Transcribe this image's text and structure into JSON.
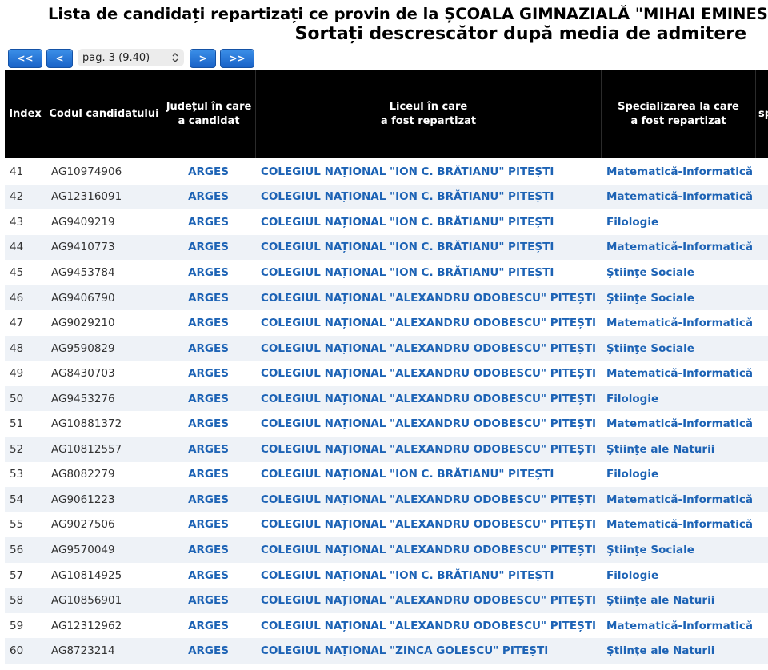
{
  "header": {
    "title": "Lista de candidați repartizați ce provin de la ȘCOALA GIMNAZIALĂ \"MIHAI EMINESCU\"",
    "subtitle": "Sortați descrescător după media de admitere"
  },
  "pager": {
    "first": "<<",
    "prev": "<",
    "select_value": "pag. 3 (9.40)",
    "next": ">",
    "last": ">>"
  },
  "table": {
    "headers": {
      "index": "Index",
      "code": "Codul candidatului",
      "judet_1": "Județul în care",
      "judet_2": "a candidat",
      "liceu_1": "Liceul în care",
      "liceu_2": "a fost repartizat",
      "spec_1": "Specializarea la care",
      "spec_2": "a fost repartizat",
      "extra": "sp"
    },
    "rows": [
      {
        "index": "41",
        "code": "AG10974906",
        "judet": "ARGES",
        "liceu": "COLEGIUL NAȚIONAL \"ION C. BRĂTIANU\" PITEȘTI",
        "spec": "Matematică-Informatică"
      },
      {
        "index": "42",
        "code": "AG12316091",
        "judet": "ARGES",
        "liceu": "COLEGIUL NAȚIONAL \"ION C. BRĂTIANU\" PITEȘTI",
        "spec": "Matematică-Informatică"
      },
      {
        "index": "43",
        "code": "AG9409219",
        "judet": "ARGES",
        "liceu": "COLEGIUL NAȚIONAL \"ION C. BRĂTIANU\" PITEȘTI",
        "spec": "Filologie"
      },
      {
        "index": "44",
        "code": "AG9410773",
        "judet": "ARGES",
        "liceu": "COLEGIUL NAȚIONAL \"ION C. BRĂTIANU\" PITEȘTI",
        "spec": "Matematică-Informatică"
      },
      {
        "index": "45",
        "code": "AG9453784",
        "judet": "ARGES",
        "liceu": "COLEGIUL NAȚIONAL \"ION C. BRĂTIANU\" PITEȘTI",
        "spec": "Ştiinţe Sociale"
      },
      {
        "index": "46",
        "code": "AG9406790",
        "judet": "ARGES",
        "liceu": "COLEGIUL NAȚIONAL \"ALEXANDRU ODOBESCU\" PITEȘTI",
        "spec": "Ştiinţe Sociale"
      },
      {
        "index": "47",
        "code": "AG9029210",
        "judet": "ARGES",
        "liceu": "COLEGIUL NAȚIONAL \"ALEXANDRU ODOBESCU\" PITEȘTI",
        "spec": "Matematică-Informatică"
      },
      {
        "index": "48",
        "code": "AG9590829",
        "judet": "ARGES",
        "liceu": "COLEGIUL NAȚIONAL \"ALEXANDRU ODOBESCU\" PITEȘTI",
        "spec": "Ştiinţe Sociale"
      },
      {
        "index": "49",
        "code": "AG8430703",
        "judet": "ARGES",
        "liceu": "COLEGIUL NAȚIONAL \"ALEXANDRU ODOBESCU\" PITEȘTI",
        "spec": "Matematică-Informatică"
      },
      {
        "index": "50",
        "code": "AG9453276",
        "judet": "ARGES",
        "liceu": "COLEGIUL NAȚIONAL \"ALEXANDRU ODOBESCU\" PITEȘTI",
        "spec": "Filologie"
      },
      {
        "index": "51",
        "code": "AG10881372",
        "judet": "ARGES",
        "liceu": "COLEGIUL NAȚIONAL \"ALEXANDRU ODOBESCU\" PITEȘTI",
        "spec": "Matematică-Informatică"
      },
      {
        "index": "52",
        "code": "AG10812557",
        "judet": "ARGES",
        "liceu": "COLEGIUL NAȚIONAL \"ALEXANDRU ODOBESCU\" PITEȘTI",
        "spec": "Ştiinţe ale Naturii"
      },
      {
        "index": "53",
        "code": "AG8082279",
        "judet": "ARGES",
        "liceu": "COLEGIUL NAȚIONAL \"ION C. BRĂTIANU\" PITEȘTI",
        "spec": "Filologie"
      },
      {
        "index": "54",
        "code": "AG9061223",
        "judet": "ARGES",
        "liceu": "COLEGIUL NAȚIONAL \"ALEXANDRU ODOBESCU\" PITEȘTI",
        "spec": "Matematică-Informatică"
      },
      {
        "index": "55",
        "code": "AG9027506",
        "judet": "ARGES",
        "liceu": "COLEGIUL NAȚIONAL \"ALEXANDRU ODOBESCU\" PITEȘTI",
        "spec": "Matematică-Informatică"
      },
      {
        "index": "56",
        "code": "AG9570049",
        "judet": "ARGES",
        "liceu": "COLEGIUL NAȚIONAL \"ALEXANDRU ODOBESCU\" PITEȘTI",
        "spec": "Ştiinţe Sociale"
      },
      {
        "index": "57",
        "code": "AG10814925",
        "judet": "ARGES",
        "liceu": "COLEGIUL NAȚIONAL \"ION C. BRĂTIANU\" PITEȘTI",
        "spec": "Filologie"
      },
      {
        "index": "58",
        "code": "AG10856901",
        "judet": "ARGES",
        "liceu": "COLEGIUL NAȚIONAL \"ALEXANDRU ODOBESCU\" PITEȘTI",
        "spec": "Ştiinţe ale Naturii"
      },
      {
        "index": "59",
        "code": "AG12312962",
        "judet": "ARGES",
        "liceu": "COLEGIUL NAȚIONAL \"ALEXANDRU ODOBESCU\" PITEȘTI",
        "spec": "Matematică-Informatică"
      },
      {
        "index": "60",
        "code": "AG8723214",
        "judet": "ARGES",
        "liceu": "COLEGIUL NAȚIONAL \"ZINCA GOLESCU\" PITEȘTI",
        "spec": "Ştiinţe ale Naturii"
      }
    ]
  },
  "colors": {
    "link_blue": "#1d63b5",
    "header_bg": "#000000",
    "alt_row_bg": "#eef2f7",
    "button_blue": "#1a63c8"
  }
}
